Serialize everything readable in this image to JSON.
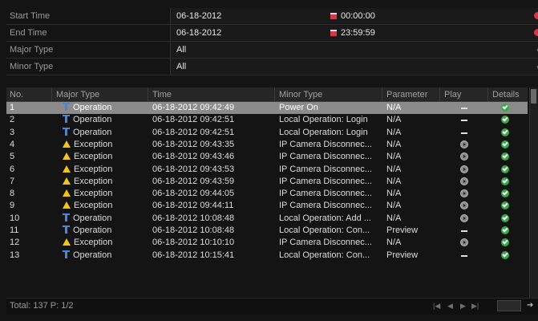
{
  "filter": {
    "start_time": {
      "label": "Start Time",
      "date": "06-18-2012",
      "time": "00:00:00"
    },
    "end_time": {
      "label": "End Time",
      "date": "06-18-2012",
      "time": "23:59:59"
    },
    "major_type": {
      "label": "Major Type",
      "value": "All"
    },
    "minor_type": {
      "label": "Minor Type",
      "value": "All"
    }
  },
  "table": {
    "headers": [
      "No.",
      "Major Type",
      "Time",
      "Minor Type",
      "Parameter",
      "Play",
      "Details"
    ],
    "rows": [
      {
        "no": "1",
        "major": "Operation",
        "icon": "operation-icon",
        "time": "06-18-2012 09:42:49",
        "minor": "Power On",
        "param": "N/A",
        "play": "dash",
        "selected": true
      },
      {
        "no": "2",
        "major": "Operation",
        "icon": "operation-icon",
        "time": "06-18-2012 09:42:51",
        "minor": "Local Operation: Login",
        "param": "N/A",
        "play": "dash"
      },
      {
        "no": "3",
        "major": "Operation",
        "icon": "operation-icon",
        "time": "06-18-2012 09:42:51",
        "minor": "Local Operation: Login",
        "param": "N/A",
        "play": "dash"
      },
      {
        "no": "4",
        "major": "Exception",
        "icon": "warning-icon",
        "time": "06-18-2012 09:43:35",
        "minor": "IP Camera Disconnec...",
        "param": "N/A",
        "play": "play"
      },
      {
        "no": "5",
        "major": "Exception",
        "icon": "warning-icon",
        "time": "06-18-2012 09:43:46",
        "minor": "IP Camera Disconnec...",
        "param": "N/A",
        "play": "play"
      },
      {
        "no": "6",
        "major": "Exception",
        "icon": "warning-icon",
        "time": "06-18-2012 09:43:53",
        "minor": "IP Camera Disconnec...",
        "param": "N/A",
        "play": "play"
      },
      {
        "no": "7",
        "major": "Exception",
        "icon": "warning-icon",
        "time": "06-18-2012 09:43:59",
        "minor": "IP Camera Disconnec...",
        "param": "N/A",
        "play": "play"
      },
      {
        "no": "8",
        "major": "Exception",
        "icon": "warning-icon",
        "time": "06-18-2012 09:44:05",
        "minor": "IP Camera Disconnec...",
        "param": "N/A",
        "play": "play"
      },
      {
        "no": "9",
        "major": "Exception",
        "icon": "warning-icon",
        "time": "06-18-2012 09:44:11",
        "minor": "IP Camera Disconnec...",
        "param": "N/A",
        "play": "play"
      },
      {
        "no": "10",
        "major": "Operation",
        "icon": "operation-icon",
        "time": "06-18-2012 10:08:48",
        "minor": "Local Operation: Add ...",
        "param": "N/A",
        "play": "play"
      },
      {
        "no": "11",
        "major": "Operation",
        "icon": "operation-icon",
        "time": "06-18-2012 10:08:48",
        "minor": "Local Operation: Con...",
        "param": "Preview",
        "play": "dash"
      },
      {
        "no": "12",
        "major": "Exception",
        "icon": "warning-icon",
        "time": "06-18-2012 10:10:10",
        "minor": "IP Camera Disconnec...",
        "param": "N/A",
        "play": "play"
      },
      {
        "no": "13",
        "major": "Operation",
        "icon": "operation-icon",
        "time": "06-18-2012 10:15:41",
        "minor": "Local Operation: Con...",
        "param": "Preview",
        "play": "dash"
      }
    ]
  },
  "footer": {
    "total": "Total: 137  P: 1/2"
  },
  "colors": {
    "selected_row": "#8b8b8b",
    "ok": "#3aa84a",
    "warning": "#f0c419",
    "operation": "#4a86d8",
    "calendar": "#d9364a"
  }
}
